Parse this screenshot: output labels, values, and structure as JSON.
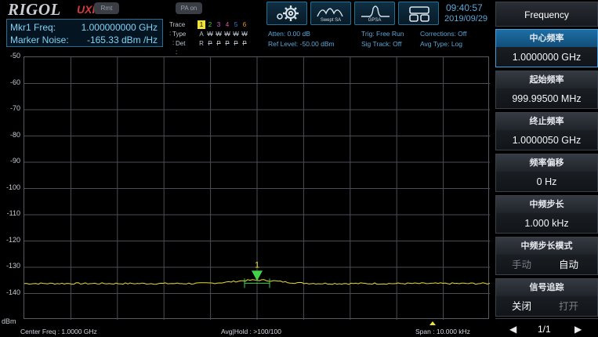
{
  "header": {
    "logo": "RIGOL",
    "logo_sub": "UXI",
    "rmt_label": "Rmt",
    "pa_label": "PA on",
    "mode_buttons": [
      {
        "label": "",
        "icon": "gear-icon"
      },
      {
        "label": "Swept SA",
        "icon": "swept-sa-icon"
      },
      {
        "label": "GPSA",
        "icon": "gpsa-icon"
      },
      {
        "label": "",
        "icon": "layout-icon"
      }
    ],
    "time": "09:40:57",
    "date": "2019/09/29"
  },
  "marker": {
    "freq_label": "Mkr1 Freq:",
    "freq_value": "1.000000000 GHz",
    "noise_label": "Marker Noise:",
    "noise_value": "-165.33 dBm /Hz"
  },
  "traces": {
    "trace_label": "Trace :",
    "type_label": "Type :",
    "det_label": "Det :",
    "numbers": [
      "1",
      "2",
      "3",
      "4",
      "5",
      "6"
    ],
    "number_colors": [
      "#f0e23a",
      "#3fd24a",
      "#d060d8",
      "#e05a9a",
      "#3f7bd8",
      "#e09a2a"
    ],
    "types": [
      "A",
      "W",
      "W",
      "W",
      "W",
      "W"
    ],
    "dets": [
      "R",
      "P",
      "P",
      "P",
      "P",
      "P"
    ]
  },
  "status": {
    "atten": "Atten: 0.00 dB",
    "ref_level": "Ref Level: -50.00 dBm",
    "trig": "Trig: Free Run",
    "sig_track": "Sig Track: Off",
    "corrections": "Corrections: Off",
    "avg_type": "Avg Type: Log"
  },
  "plot": {
    "y_labels": [
      "-50",
      "-60",
      "-70",
      "-80",
      "-90",
      "-100",
      "-110",
      "-120",
      "-130",
      "-140"
    ],
    "y_unit": "dBm",
    "marker_label": "1",
    "trace_color": "#e8dc3a",
    "marker_color": "#3fd24a"
  },
  "footer": {
    "center_freq": "Center Freq : 1.0000 GHz",
    "avg_hold": "Avg|Hold : >100/100",
    "span": "Span : 10.000 kHz"
  },
  "panel": {
    "title": "Frequency",
    "keys": [
      {
        "title": "中心频率",
        "value": "1.0000000 GHz",
        "active": true
      },
      {
        "title": "起始频率",
        "value": "999.99500 MHz",
        "active": false
      },
      {
        "title": "终止频率",
        "value": "1.0000050 GHz",
        "active": false
      },
      {
        "title": "频率偏移",
        "value": "0 Hz",
        "active": false
      },
      {
        "title": "中频步长",
        "value": "1.000 kHz",
        "active": false
      }
    ],
    "step_mode": {
      "title": "中频步长模式",
      "opt_a": "手动",
      "opt_b": "自动"
    },
    "sig_track": {
      "title": "信号追踪",
      "opt_a": "关闭",
      "opt_b": "打开"
    },
    "pager": "1/1"
  }
}
